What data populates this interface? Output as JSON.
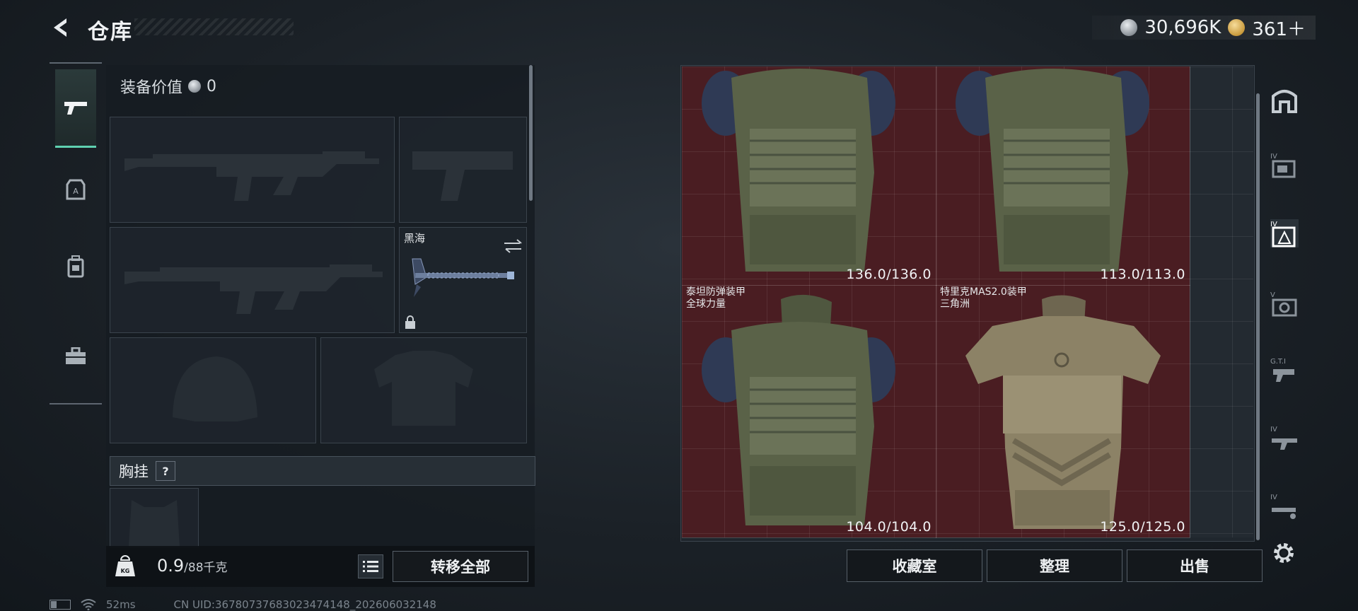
{
  "header": {
    "title": "仓库"
  },
  "currency": {
    "silver": "30,696K",
    "gold": "361＋"
  },
  "equipment": {
    "value_label": "装备价值",
    "value": "0",
    "melee_slot_name": "黑海",
    "chest_rig_label": "胸挂",
    "help_label": "?"
  },
  "weight": {
    "current": "0.9",
    "unit": "/88千克"
  },
  "buttons": {
    "transfer_all": "转移全部",
    "collection": "收藏室",
    "sort": "整理",
    "sell": "出售"
  },
  "items": [
    {
      "name_line1": "",
      "name_line2": "",
      "durability": "136.0/136.0"
    },
    {
      "name_line1": "",
      "name_line2": "",
      "durability": "113.0/113.0"
    },
    {
      "name_line1": "泰坦防弹装甲",
      "name_line2": "全球力量",
      "durability": "104.0/104.0"
    },
    {
      "name_line1": "特里克MAS2.0装甲",
      "name_line2": "三角洲",
      "durability": "125.0/125.0"
    }
  ],
  "right_tabs": [
    "home-icon",
    "tier-iv-gear-icon",
    "tier-iv-armor-icon",
    "tier-v-armor-icon",
    "gti-icon",
    "tier-iv-weapon-icon",
    "tier-iv-ammo-icon"
  ],
  "status": {
    "ping": "52ms",
    "uid": "CN UID:367807376830234741​48_202606032148"
  },
  "colors": {
    "accent": "#5fd0b0",
    "grid_red": "#4a1d22",
    "panel": "#1f262d"
  }
}
